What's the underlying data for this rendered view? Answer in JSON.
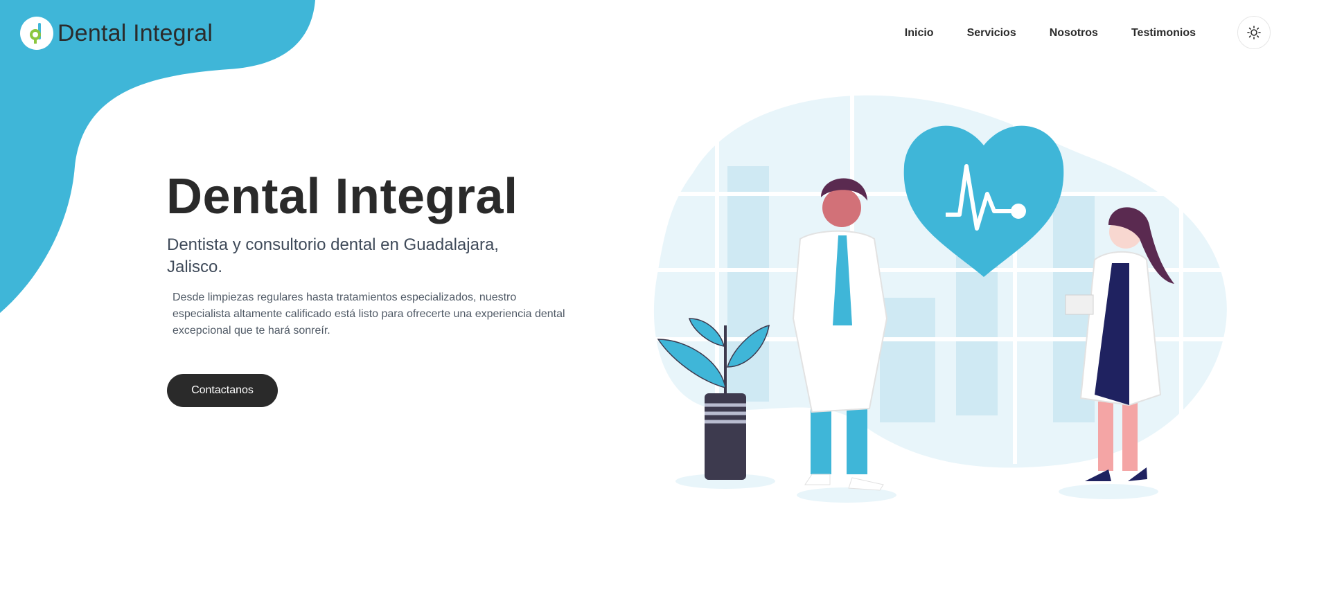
{
  "colors": {
    "accent": "#3fb6d8",
    "dark": "#2a2a2a",
    "logo_green": "#8cc63f",
    "illustration_light": "#e8f5fa",
    "skin": "#d27178",
    "hair": "#5a2a50",
    "navy": "#1f2260",
    "pot": "#3d3a4e"
  },
  "header": {
    "brand": "Dental Integral",
    "logo_icon": "tooth-d-logo",
    "nav": [
      "Inicio",
      "Servicios",
      "Nosotros",
      "Testimonios"
    ],
    "theme_icon": "sun-icon"
  },
  "hero": {
    "title": "Dental Integral",
    "subtitle": "Dentista y consultorio dental en Guadalajara, Jalisco.",
    "description": "Desde limpiezas regulares hasta tratamientos especializados, nuestro especialista altamente calificado está listo para ofrecerte una experiencia dental excepcional que te hará sonreír.",
    "cta_label": "Contactanos"
  }
}
